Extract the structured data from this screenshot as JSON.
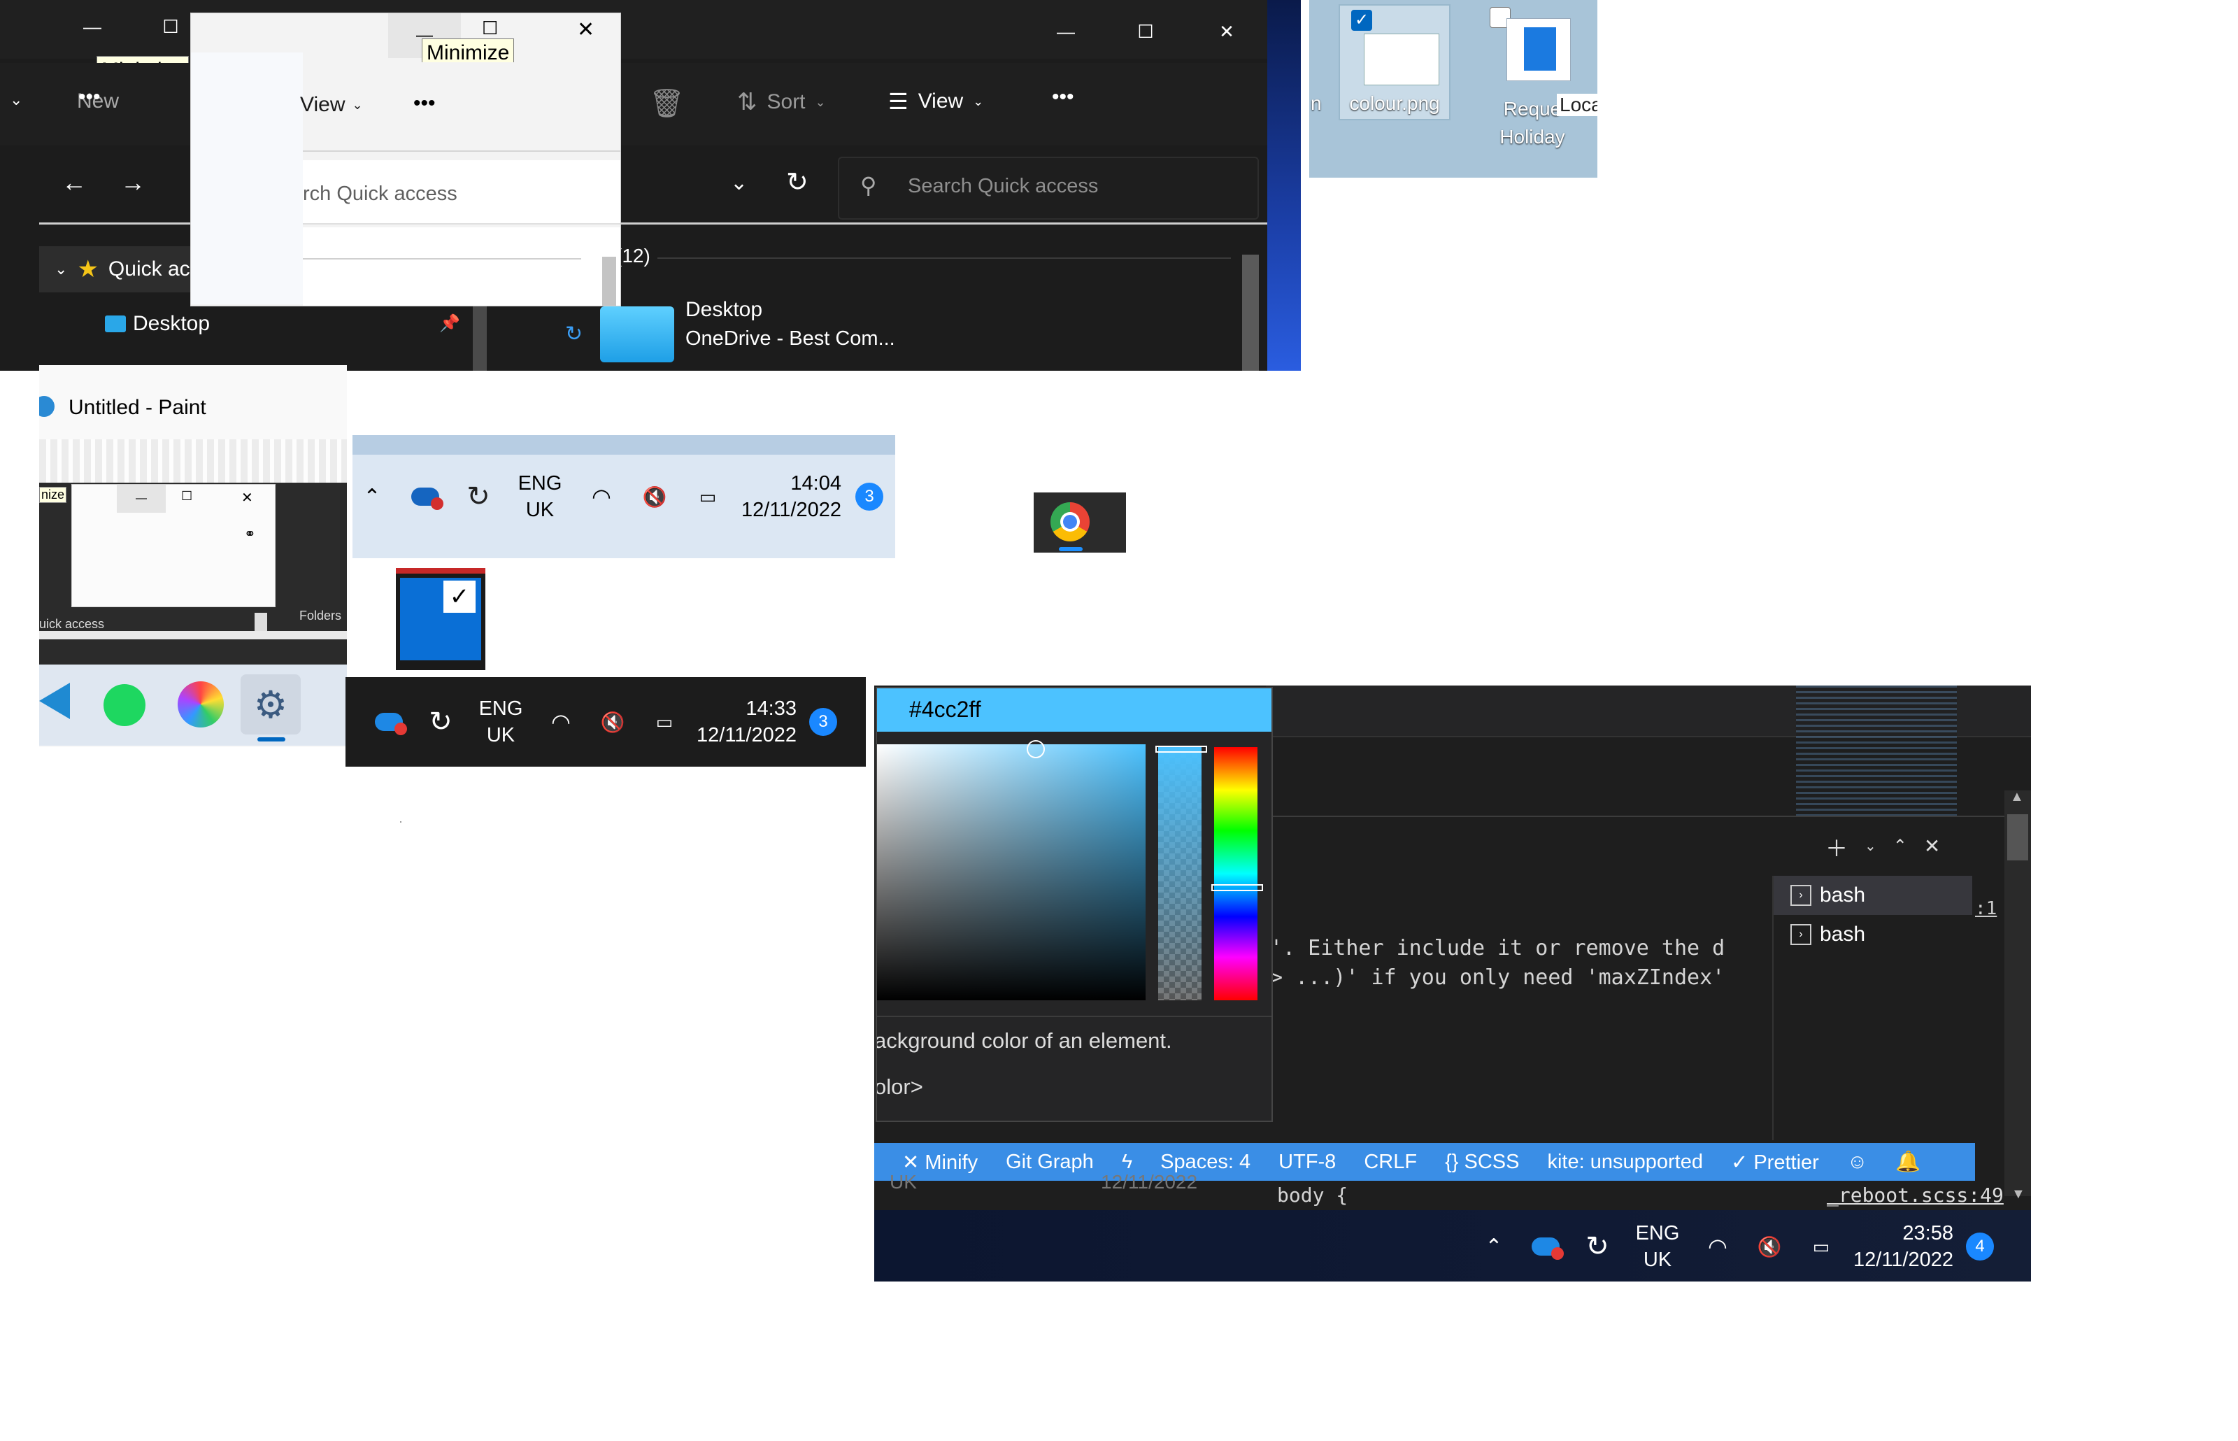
{
  "explorer_dark": {
    "minimize_tooltip": "Minimize",
    "toolbar": {
      "new_label": "New",
      "sort_label": "Sort",
      "view_label": "View",
      "more_label": "•••"
    },
    "search_placeholder": "Search Quick access",
    "nav": {
      "quick_access_label": "Quick access",
      "desktop_label": "Desktop"
    },
    "group_header": "(12)",
    "item": {
      "name": "Desktop",
      "sub": "OneDrive - Best Com..."
    }
  },
  "explorer_light": {
    "minimize_tooltip": "Minimize",
    "view_label": "View",
    "more_label": "•••",
    "search_placeholder": "rch Quick access"
  },
  "desktop_icons": [
    {
      "label": "colour.png",
      "checked": true
    },
    {
      "label": "Reque Holiday",
      "checked": false
    }
  ],
  "desktop_extra": {
    "left_fragment": "n",
    "right_fragment": "Loca"
  },
  "paint": {
    "title": "Untitled - Paint",
    "tooltip_fragment": "nize",
    "quick_access_fragment": "uick access",
    "folders_label": "Folders"
  },
  "taskbar_light": {
    "lang": "ENG",
    "region": "UK",
    "time": "14:04",
    "date": "12/11/2022",
    "badge": "3"
  },
  "taskbar_dark": {
    "lang": "ENG",
    "region": "UK",
    "time": "14:33",
    "date": "12/11/2022",
    "badge": "3"
  },
  "taskbar_code": {
    "lang": "ENG",
    "region": "UK",
    "time": "23:58",
    "date": "12/11/2022",
    "badge": "4",
    "ghost_region": "UK",
    "ghost_date": "12/11/2022"
  },
  "color_picker": {
    "hex": "#4cc2ff",
    "hover_line1": "ackground color of an element.",
    "hover_line2": "olor>"
  },
  "editor": {
    "line1": "'. Either include it or remove the d",
    "line2": "> ...)' if you only need 'maxZIndex'",
    "terminals": [
      "bash",
      "bash"
    ],
    "link_fragment": ":1",
    "body_line": "body {",
    "file_ref": "_reboot.scss:49"
  },
  "status_bar": {
    "minify": "Minify",
    "git_graph": "Git Graph",
    "spaces": "Spaces: 4",
    "encoding": "UTF-8",
    "eol": "CRLF",
    "language": "SCSS",
    "kite": "kite: unsupported",
    "prettier": "Prettier"
  },
  "colors": {
    "accent_blue": "#0067c0",
    "picked_color": "#4cc2ff",
    "status_bar_blue": "#3a8ee6",
    "dark_bg": "#1c1c1c"
  },
  "icons": [
    "onedrive-icon",
    "sync-icon",
    "wifi-icon",
    "mute-icon",
    "battery-icon",
    "chrome-icon",
    "spotify-icon",
    "settings-icon",
    "vscode-icon",
    "paint-icon"
  ]
}
